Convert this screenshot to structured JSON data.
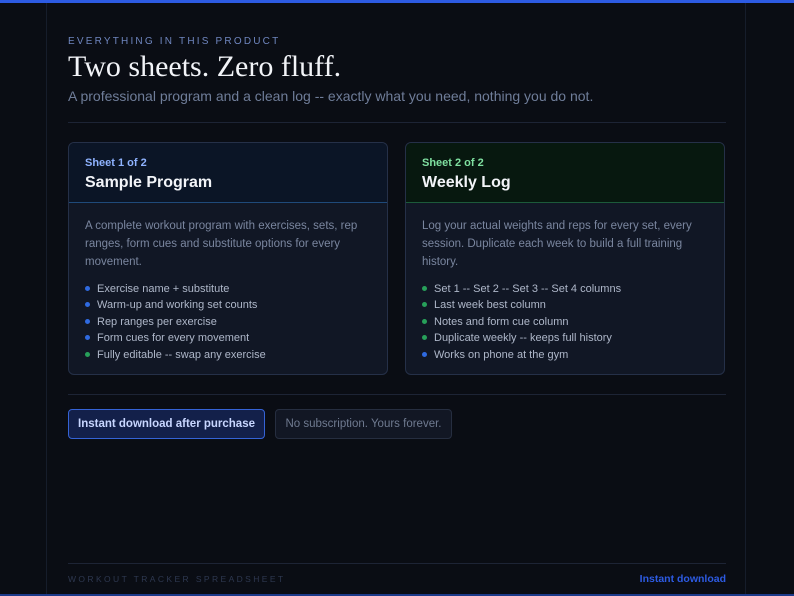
{
  "colors": {
    "accent": "#2d5be3",
    "background": "#0a0d14",
    "program_tag": "#8fb3ff",
    "log_tag": "#7fe0a0",
    "bullet_blue": "#2f6ae0",
    "bullet_green": "#27a05a"
  },
  "header": {
    "eyebrow": "EVERYTHING IN THIS PRODUCT",
    "title": "Two sheets. Zero fluff.",
    "subtitle": "A professional program and a clean log -- exactly what you need, nothing you do not."
  },
  "cards": [
    {
      "tag": "Sheet 1 of 2",
      "name": "Sample Program",
      "description": "A complete workout program with exercises, sets, rep ranges, form cues and substitute options for every movement.",
      "features": [
        {
          "text": "Exercise name + substitute",
          "bullet": "blue"
        },
        {
          "text": "Warm-up and working set counts",
          "bullet": "blue"
        },
        {
          "text": "Rep ranges per exercise",
          "bullet": "blue"
        },
        {
          "text": "Form cues for every movement",
          "bullet": "blue"
        },
        {
          "text": "Fully editable -- swap any exercise",
          "bullet": "green"
        }
      ]
    },
    {
      "tag": "Sheet 2 of 2",
      "name": "Weekly Log",
      "description": "Log your actual weights and reps for every set, every session. Duplicate each week to build a full training history.",
      "features": [
        {
          "text": "Set 1 -- Set 2 -- Set 3 -- Set 4 columns",
          "bullet": "green"
        },
        {
          "text": "Last week best column",
          "bullet": "green"
        },
        {
          "text": "Notes and form cue column",
          "bullet": "green"
        },
        {
          "text": "Duplicate weekly -- keeps full history",
          "bullet": "green"
        },
        {
          "text": "Works on phone at the gym",
          "bullet": "blue"
        }
      ]
    }
  ],
  "actions": {
    "primary_label": "Instant download after purchase",
    "note": "No subscription. Yours forever."
  },
  "footer": {
    "product_name": "WORKOUT TRACKER SPREADSHEET",
    "link_label": "Instant download"
  }
}
